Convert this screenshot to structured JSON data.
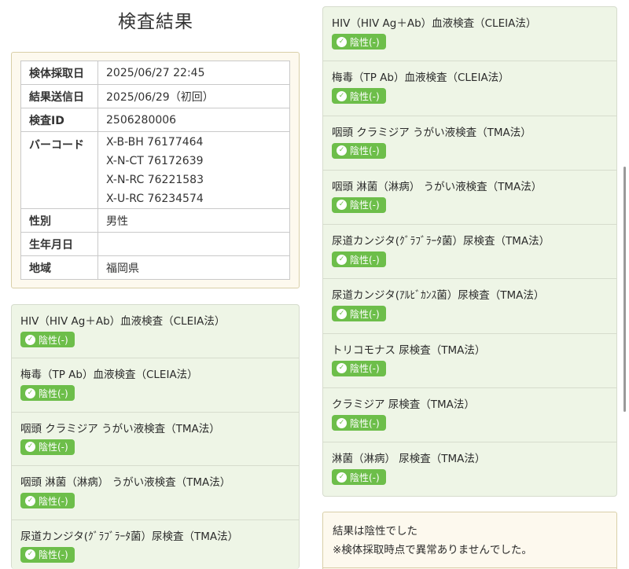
{
  "page": {
    "title": "検査結果"
  },
  "info": {
    "collection_label": "検体採取日",
    "collection_value": "2025/06/27  22:45",
    "sent_label": "結果送信日",
    "sent_value": "2025/06/29（初回）",
    "test_id_label": "検査ID",
    "test_id_value": "2506280006",
    "barcode_label": "バーコード",
    "barcodes": [
      "X-B-BH  76177464",
      "X-N-CT  76172639",
      "X-N-RC  76221583",
      "X-U-RC  76234574"
    ],
    "sex_label": "性別",
    "sex_value": "男性",
    "birth_label": "生年月日",
    "birth_value": "",
    "region_label": "地域",
    "region_value": "福岡県"
  },
  "tests": [
    {
      "name": "HIV（HIV  Ag＋Ab）血液検査（CLEIA法）",
      "result": "陰性(-)"
    },
    {
      "name": "梅毒（TP  Ab）血液検査（CLEIA法）",
      "result": "陰性(-)"
    },
    {
      "name": "咽頭  クラミジア  うがい液検査（TMA法）",
      "result": "陰性(-)"
    },
    {
      "name": "咽頭  淋菌（淋病）  うがい液検査（TMA法）",
      "result": "陰性(-)"
    },
    {
      "name": "尿道カンジタ(ｸﾞﾗﾌﾞﾗｰﾀ菌）尿検査（TMA法）",
      "result": "陰性(-)"
    },
    {
      "name": "尿道カンジタ(ｱﾙﾋﾞｶﾝｽ菌）尿検査（TMA法）",
      "result": "陰性(-)"
    },
    {
      "name": "トリコモナス  尿検査（TMA法）",
      "result": "陰性(-)"
    },
    {
      "name": "クラミジア  尿検査（TMA法）",
      "result": "陰性(-)"
    },
    {
      "name": "淋菌（淋病）  尿検査（TMA法）",
      "result": "陰性(-)"
    }
  ],
  "summary": {
    "line1": "結果は陰性でした",
    "line2": "※検体採取時点で異常ありませんでした。"
  },
  "icons": {
    "badge_icon": "check-circle-icon"
  },
  "colors": {
    "badge": "#6dbe4a",
    "test_card_bg": "#eef5e6",
    "info_card_bg": "#fdf9ee"
  }
}
